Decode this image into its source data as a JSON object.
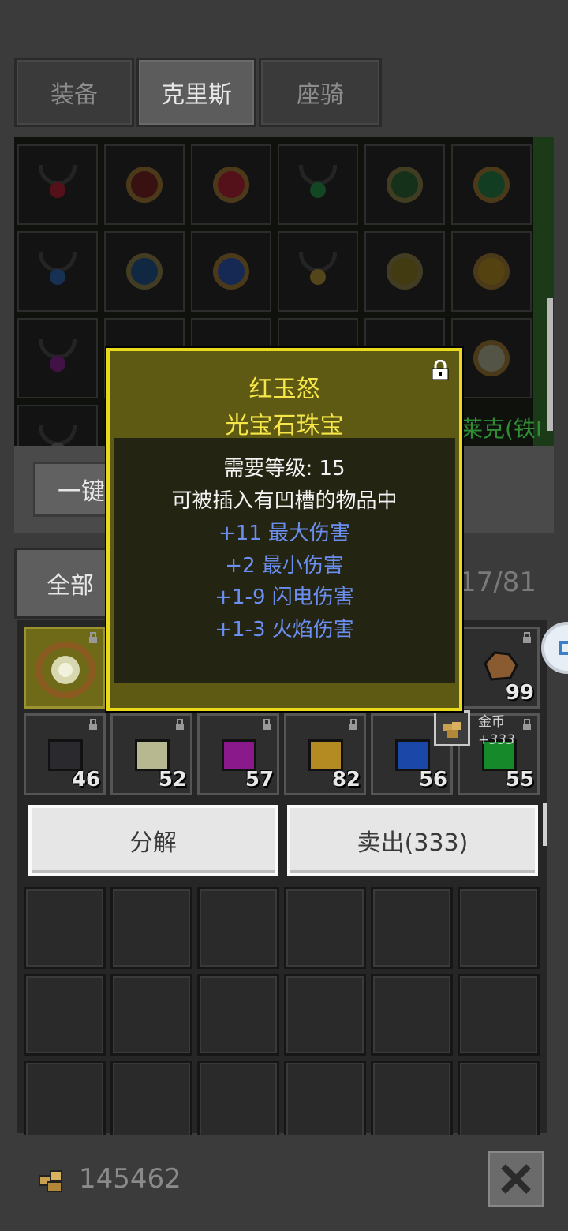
{
  "tabs": [
    {
      "label": "装备",
      "active": false
    },
    {
      "label": "克里斯",
      "active": true
    },
    {
      "label": "座骑",
      "active": false
    }
  ],
  "buttons": {
    "one_key": "一键",
    "filter_all": "全部",
    "decompose": "分解",
    "sell": "卖出(333)"
  },
  "link_text": "莱克(铁I",
  "inventory_count": "17/81",
  "tooltip": {
    "name": "红玉怒",
    "type": "光宝石珠宝",
    "requirement": "需要等级: 15",
    "description": "可被插入有凹槽的物品中",
    "stats": [
      "+11 最大伤害",
      "+2 最小伤害",
      "+1-9 闪电伤害",
      "+1-3 火焰伤害"
    ]
  },
  "gold_tip": {
    "label": "金币",
    "value": "+333"
  },
  "inventory_row1": [
    {
      "name": "selected-gem-amulet",
      "qty": ""
    },
    {
      "name": "ore-item",
      "qty": "99"
    }
  ],
  "inventory_row2": [
    {
      "name": "black-gem",
      "qty": "46",
      "color": "#2a2a2e"
    },
    {
      "name": "white-gem",
      "qty": "52",
      "color": "#b8b890"
    },
    {
      "name": "purple-gem",
      "qty": "57",
      "color": "#8a1a8c"
    },
    {
      "name": "yellow-gem",
      "qty": "82",
      "color": "#b48a22"
    },
    {
      "name": "blue-gem",
      "qty": "56",
      "color": "#1b47a8"
    },
    {
      "name": "green-gem",
      "qty": "55",
      "color": "#168a2a"
    }
  ],
  "gold_amount": "145462"
}
